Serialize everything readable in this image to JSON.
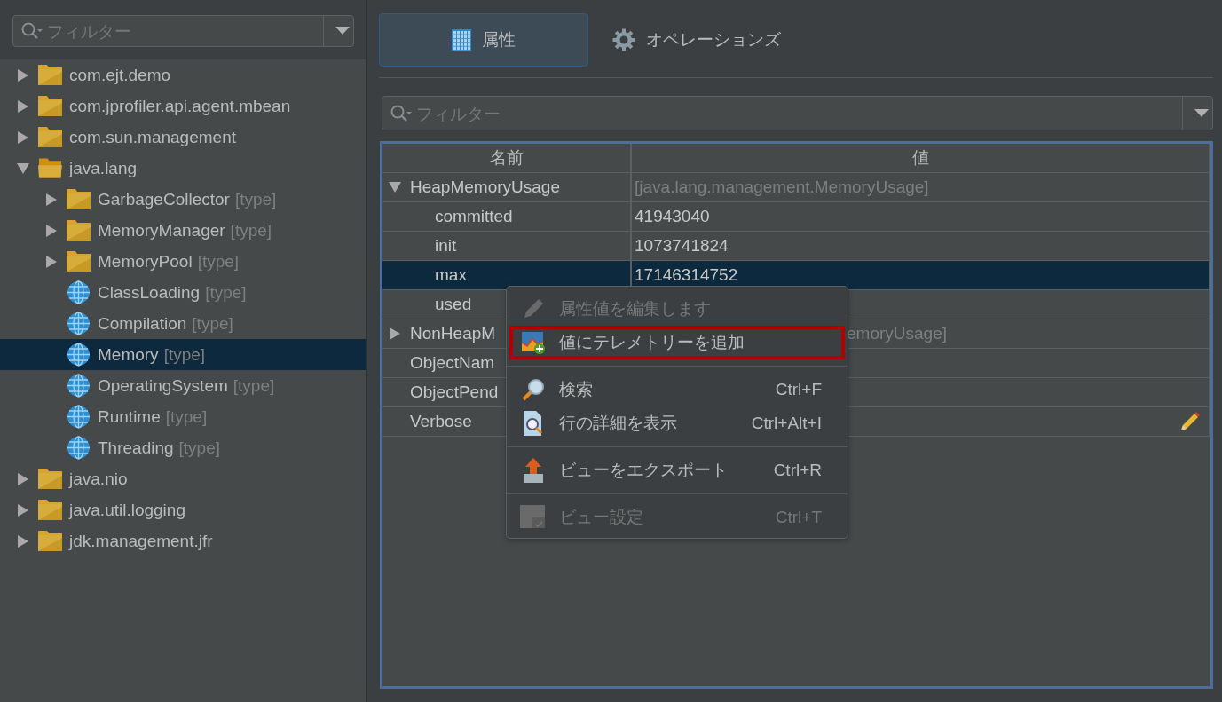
{
  "sidebar": {
    "filter": {
      "placeholder": "フィルター"
    },
    "tree": [
      {
        "label": "com.ejt.demo",
        "kind": "folder",
        "expanded": false,
        "selected": false
      },
      {
        "label": "com.jprofiler.api.agent.mbean",
        "kind": "folder",
        "expanded": false,
        "selected": false
      },
      {
        "label": "com.sun.management",
        "kind": "folder",
        "expanded": false,
        "selected": false
      },
      {
        "label": "java.lang",
        "kind": "folder",
        "expanded": true,
        "selected": false,
        "children": [
          {
            "label": "GarbageCollector",
            "suffix": "[type]",
            "kind": "folder",
            "expanded": false,
            "selected": false
          },
          {
            "label": "MemoryManager",
            "suffix": "[type]",
            "kind": "folder",
            "expanded": false,
            "selected": false
          },
          {
            "label": "MemoryPool",
            "suffix": "[type]",
            "kind": "folder",
            "expanded": false,
            "selected": false
          },
          {
            "label": "ClassLoading",
            "suffix": "[type]",
            "kind": "mbean",
            "selected": false
          },
          {
            "label": "Compilation",
            "suffix": "[type]",
            "kind": "mbean",
            "selected": false
          },
          {
            "label": "Memory",
            "suffix": "[type]",
            "kind": "mbean",
            "selected": true
          },
          {
            "label": "OperatingSystem",
            "suffix": "[type]",
            "kind": "mbean",
            "selected": false
          },
          {
            "label": "Runtime",
            "suffix": "[type]",
            "kind": "mbean",
            "selected": false
          },
          {
            "label": "Threading",
            "suffix": "[type]",
            "kind": "mbean",
            "selected": false
          }
        ]
      },
      {
        "label": "java.nio",
        "kind": "folder",
        "expanded": false,
        "selected": false
      },
      {
        "label": "java.util.logging",
        "kind": "folder",
        "expanded": false,
        "selected": false
      },
      {
        "label": "jdk.management.jfr",
        "kind": "folder",
        "expanded": false,
        "selected": false
      }
    ]
  },
  "tabs": [
    {
      "label": "属性",
      "selected": true
    },
    {
      "label": "オペレーションズ",
      "selected": false
    }
  ],
  "filter": {
    "placeholder": "フィルター"
  },
  "table": {
    "columns": [
      "名前",
      "値"
    ],
    "rows": [
      {
        "name": "HeapMemoryUsage",
        "value": "[java.lang.management.MemoryUsage]",
        "value_greyed": true,
        "expanded": true,
        "selected": false,
        "children": [
          {
            "name": "committed",
            "value": "41943040",
            "selected": false
          },
          {
            "name": "init",
            "value": "1073741824",
            "selected": false
          },
          {
            "name": "max",
            "value": "17146314752",
            "selected": true
          },
          {
            "name": "used",
            "selected": false
          }
        ]
      },
      {
        "name": "NonHeapM",
        "value": "emoryUsage]",
        "value_greyed": true,
        "value_covered": true,
        "expanded": false,
        "selected": false
      },
      {
        "name": "ObjectNam",
        "selected": false
      },
      {
        "name": "ObjectPend",
        "selected": false
      },
      {
        "name": "Verbose",
        "editable": true,
        "selected": false
      }
    ]
  },
  "context_menu": {
    "items": [
      {
        "kind": "item",
        "label": "属性値を編集します",
        "disabled": true,
        "highlighted": false
      },
      {
        "kind": "item",
        "label": "値にテレメトリーを追加",
        "disabled": false,
        "highlighted": true
      },
      {
        "kind": "separator"
      },
      {
        "kind": "item",
        "label": "検索",
        "shortcut": "Ctrl+F",
        "disabled": false,
        "highlighted": false
      },
      {
        "kind": "item",
        "label": "行の詳細を表示",
        "shortcut": "Ctrl+Alt+I",
        "disabled": false,
        "highlighted": false
      },
      {
        "kind": "separator"
      },
      {
        "kind": "item",
        "label": "ビューをエクスポート",
        "shortcut": "Ctrl+R",
        "disabled": false,
        "highlighted": false
      },
      {
        "kind": "separator"
      },
      {
        "kind": "item",
        "label": "ビュー設定",
        "shortcut": "Ctrl+T",
        "disabled": true,
        "highlighted": false
      }
    ]
  }
}
